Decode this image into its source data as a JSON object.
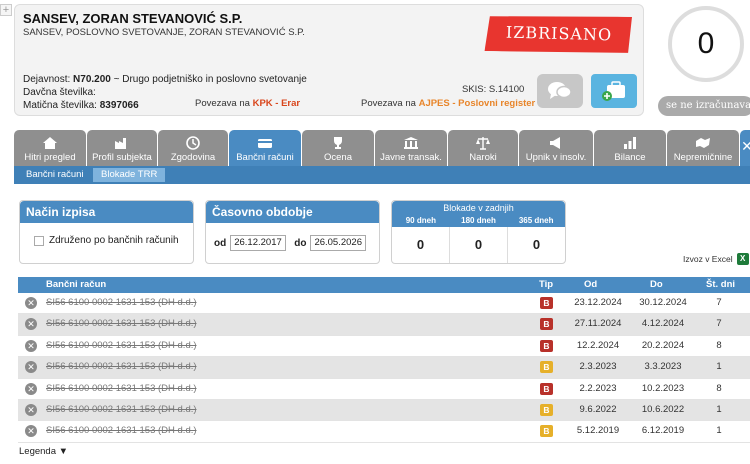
{
  "company": {
    "name": "SANSEV, ZORAN STEVANOVIĆ S.P.",
    "full_name": "SANSEV, POSLOVNO SVETOVANJE, ZORAN STEVANOVIĆ S.P.",
    "stamp": "IZBRISANO",
    "dejavnost_label": "Dejavnost:",
    "dejavnost_code": "N70.200",
    "dejavnost_text": " ~ Drugo podjetniško in poslovno svetovanje",
    "davcna_label": "Davčna številka:",
    "maticna_label": "Matična številka:",
    "maticna_value": "8397066",
    "skis": "SKIS: S.14100",
    "kpk_prefix": "Povezava na ",
    "kpk_link": "KPK - Erar",
    "ajpes_prefix": "Povezava na ",
    "ajpes_link": "AJPES - Poslovni register"
  },
  "score": {
    "value": "0",
    "badge": "se ne izračunava"
  },
  "tabs": [
    {
      "label": "Hitri pregled",
      "icon": "home-icon"
    },
    {
      "label": "Profil subjekta",
      "icon": "factory-icon"
    },
    {
      "label": "Zgodovina",
      "icon": "clock-icon"
    },
    {
      "label": "Bančni računi",
      "icon": "bank-card-icon"
    },
    {
      "label": "Ocena",
      "icon": "trophy-icon"
    },
    {
      "label": "Javne transak.",
      "icon": "building-icon"
    },
    {
      "label": "Naroki",
      "icon": "scales-icon"
    },
    {
      "label": "Upnik v insolv.",
      "icon": "megaphone-icon"
    },
    {
      "label": "Bilance",
      "icon": "chart-icon"
    },
    {
      "label": "Nepremičnine",
      "icon": "map-icon"
    }
  ],
  "subtabs": [
    "Bančni računi",
    "Blokade TRR"
  ],
  "nacin": {
    "title": "Način izpisa",
    "checkbox_label": "Združeno po bančnih računih"
  },
  "obdobje": {
    "title": "Časovno obdobje",
    "od_label": "od",
    "od_value": "26.12.2017",
    "do_label": "do",
    "do_value": "26.05.2026"
  },
  "blokade": {
    "title": "Blokade v zadnjih",
    "col1": "90 dneh",
    "col2": "180 dneh",
    "col3": "365 dneh",
    "val1": "0",
    "val2": "0",
    "val3": "0"
  },
  "excel_label": "Izvoz v Excel",
  "table": {
    "headers": {
      "account": "Bančni račun",
      "tip": "Tip",
      "od": "Od",
      "do": "Do",
      "days": "Št. dni"
    },
    "rows": [
      {
        "account": "SI56 6100 0002 1631 153 (DH d.d.)",
        "tip": "B",
        "tip_color": "#b8312a",
        "od": "23.12.2024",
        "do": "30.12.2024",
        "days": "7"
      },
      {
        "account": "SI56 6100 0002 1631 153 (DH d.d.)",
        "tip": "B",
        "tip_color": "#b8312a",
        "od": "27.11.2024",
        "do": "4.12.2024",
        "days": "7"
      },
      {
        "account": "SI56 6100 0002 1631 153 (DH d.d.)",
        "tip": "B",
        "tip_color": "#b8312a",
        "od": "12.2.2024",
        "do": "20.2.2024",
        "days": "8"
      },
      {
        "account": "SI56 6100 0002 1631 153 (DH d.d.)",
        "tip": "B",
        "tip_color": "#e6b02a",
        "od": "2.3.2023",
        "do": "3.3.2023",
        "days": "1"
      },
      {
        "account": "SI56 6100 0002 1631 153 (DH d.d.)",
        "tip": "B",
        "tip_color": "#b8312a",
        "od": "2.2.2023",
        "do": "10.2.2023",
        "days": "8"
      },
      {
        "account": "SI56 6100 0002 1631 153 (DH d.d.)",
        "tip": "B",
        "tip_color": "#e6b02a",
        "od": "9.6.2022",
        "do": "10.6.2022",
        "days": "1"
      },
      {
        "account": "SI56 6100 0002 1631 153 (DH d.d.)",
        "tip": "B",
        "tip_color": "#e6b02a",
        "od": "5.12.2019",
        "do": "6.12.2019",
        "days": "1"
      }
    ]
  },
  "legenda": "Legenda ▼"
}
